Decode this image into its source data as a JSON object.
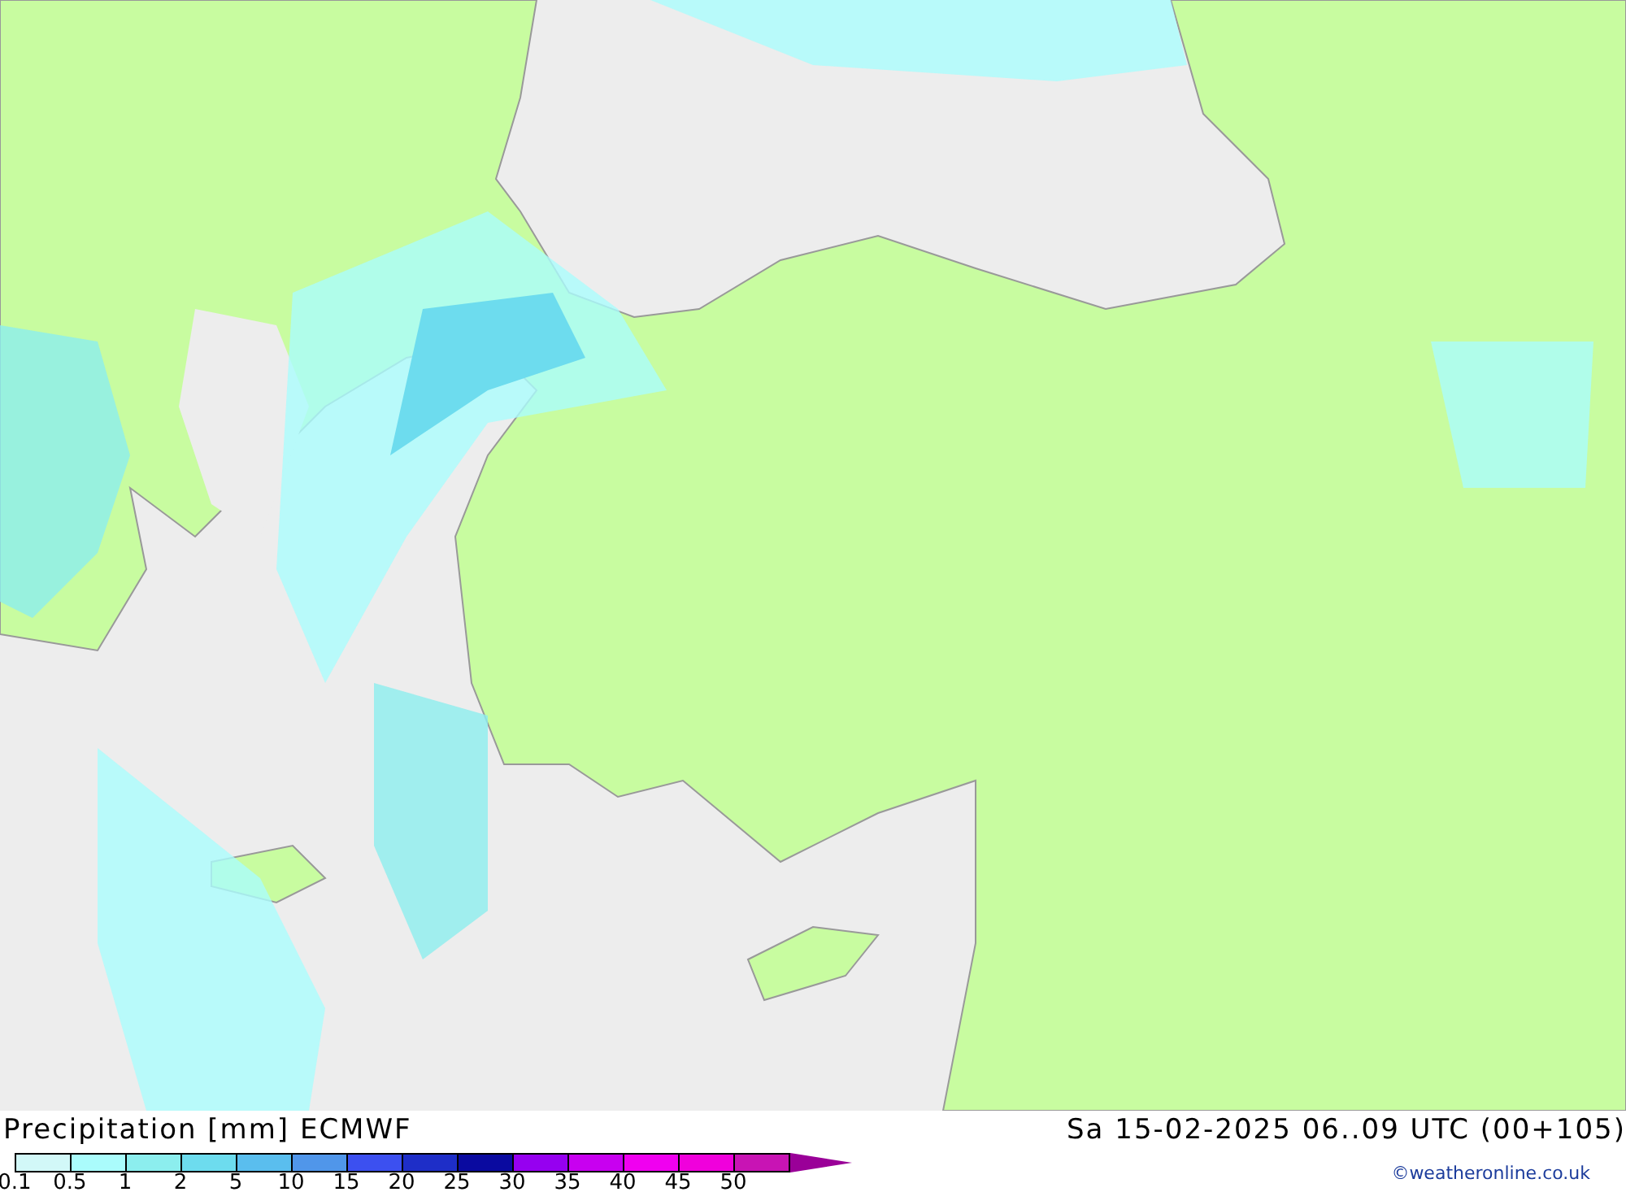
{
  "map": {
    "title": "Precipitation [mm] ECMWF",
    "valid_time": "Sa 15-02-2025 06..09 UTC (00+105)",
    "credit": "©weatheronline.co.uk"
  },
  "legend": {
    "bins": [
      {
        "color": "#d2f8f8"
      },
      {
        "color": "#aafcfc"
      },
      {
        "color": "#8ceeee"
      },
      {
        "color": "#6ddcee"
      },
      {
        "color": "#5abeee"
      },
      {
        "color": "#5096ea"
      },
      {
        "color": "#3c50f0"
      },
      {
        "color": "#1e2ec8"
      },
      {
        "color": "#0a0aa0"
      },
      {
        "color": "#9600f0"
      },
      {
        "color": "#c800f0"
      },
      {
        "color": "#f000f0"
      },
      {
        "color": "#f000dc"
      },
      {
        "color": "#c814b4"
      }
    ],
    "ticks": [
      "0.1",
      "0.5",
      "1",
      "2",
      "5",
      "10",
      "15",
      "20",
      "25",
      "30",
      "35",
      "40",
      "45",
      "50"
    ]
  }
}
